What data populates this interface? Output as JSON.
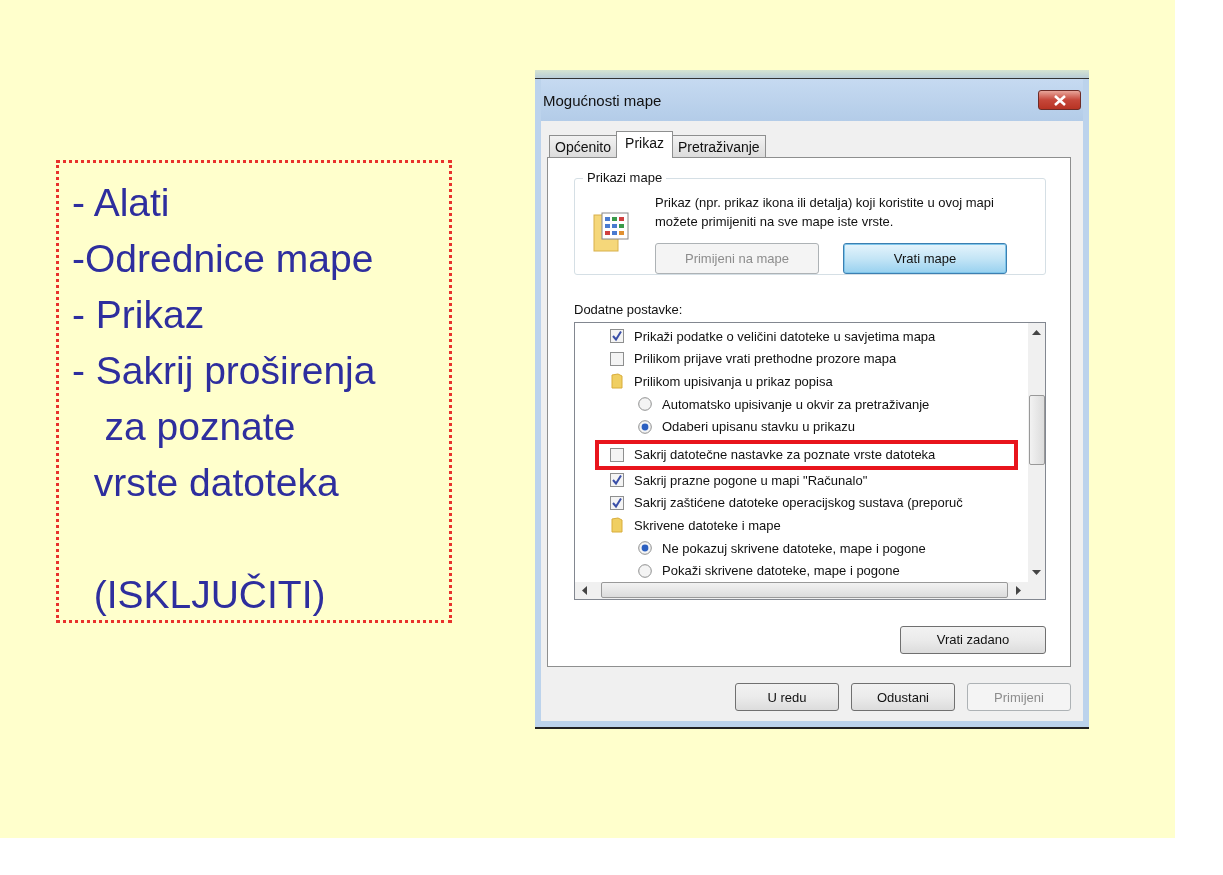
{
  "notes": {
    "text": "- Alati\n-Odrednice mape\n- Prikaz\n- Sakrij proširenja\n   za poznate\n  vrste datoteka\n\n  (ISKLJUČITI)"
  },
  "window": {
    "title": "Mogućnosti mape"
  },
  "tabs": [
    {
      "label": "Općenito",
      "selected": false
    },
    {
      "label": "Prikaz",
      "selected": true
    },
    {
      "label": "Pretraživanje",
      "selected": false
    }
  ],
  "folder_views": {
    "title": "Prikazi mape",
    "description": "Prikaz (npr. prikaz ikona ili detalja) koji koristite u ovoj mapi možete primijeniti na sve mape iste vrste.",
    "buttons": [
      {
        "label": "Primijeni na mape",
        "disabled": true,
        "focused": false
      },
      {
        "label": "Vrati mape",
        "disabled": false,
        "focused": true
      }
    ]
  },
  "advanced": {
    "label": "Dodatne postavke:",
    "items": [
      {
        "kind": "checkbox",
        "label": "Prikaži podatke o veličini datoteke u savjetima mapa",
        "checked": true,
        "highlighted": false
      },
      {
        "kind": "checkbox",
        "label": "Prilikom prijave vrati prethodne prozore mapa",
        "checked": false,
        "highlighted": false
      },
      {
        "kind": "folder",
        "label": "Prilikom upisivanja u prikaz popisa",
        "children": [
          {
            "kind": "radio",
            "label": "Automatsko upisivanje u okvir za pretraživanje",
            "selected": false
          },
          {
            "kind": "radio",
            "label": "Odaberi upisanu stavku u prikazu",
            "selected": true
          }
        ]
      },
      {
        "kind": "checkbox",
        "label": "Sakrij datotečne nastavke za poznate vrste datoteka",
        "checked": false,
        "highlighted": true
      },
      {
        "kind": "checkbox",
        "label": "Sakrij prazne pogone u mapi \"Računalo\"",
        "checked": true,
        "highlighted": false
      },
      {
        "kind": "checkbox",
        "label": "Sakrij zaštićene datoteke operacijskog sustava (preporuč",
        "checked": true,
        "highlighted": false
      },
      {
        "kind": "folder",
        "label": "Skrivene datoteke i mape",
        "children": [
          {
            "kind": "radio",
            "label": "Ne pokazuj skrivene datoteke, mape i pogone",
            "selected": true
          },
          {
            "kind": "radio",
            "label": "Pokaži skrivene datoteke, mape i pogone",
            "selected": false
          }
        ]
      }
    ]
  },
  "restore_button": {
    "label": "Vrati zadano"
  },
  "buttons": [
    {
      "label": "U redu",
      "disabled": false
    },
    {
      "label": "Odustani",
      "disabled": false
    },
    {
      "label": "Primijeni",
      "disabled": true
    }
  ]
}
